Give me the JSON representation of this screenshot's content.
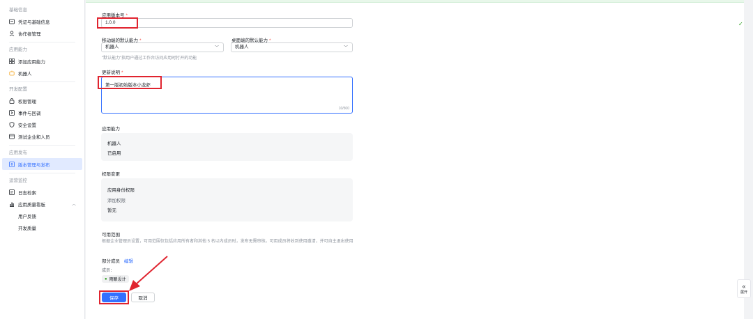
{
  "sidebar": {
    "sections": [
      {
        "title": "基础信息",
        "items": [
          {
            "label": "凭证与基础信息",
            "icon": "id-card-icon"
          },
          {
            "label": "协作者管理",
            "icon": "user-icon"
          }
        ]
      },
      {
        "title": "应用能力",
        "items": [
          {
            "label": "添加应用能力",
            "icon": "grid-icon"
          },
          {
            "label": "机器人",
            "icon": "robot-icon"
          }
        ]
      },
      {
        "title": "开发配置",
        "items": [
          {
            "label": "权限管理",
            "icon": "lock-icon"
          },
          {
            "label": "事件与回调",
            "icon": "event-icon"
          },
          {
            "label": "安全设置",
            "icon": "shield-icon"
          },
          {
            "label": "测试企业和人员",
            "icon": "test-icon"
          }
        ]
      },
      {
        "title": "应用发布",
        "items": [
          {
            "label": "版本管理与发布",
            "icon": "publish-icon"
          }
        ]
      },
      {
        "title": "运营监控",
        "items": [
          {
            "label": "日志检索",
            "icon": "log-icon"
          },
          {
            "label": "应用质量看板",
            "icon": "chart-icon"
          },
          {
            "label": "用户反馈",
            "icon": ""
          },
          {
            "label": "开发质量",
            "icon": ""
          }
        ]
      }
    ]
  },
  "form": {
    "version_label": "应用版本号",
    "version_value": "1.0.0",
    "mobile_default_label": "移动端的默认能力",
    "mobile_default_value": "机器人",
    "desktop_default_label": "桌面端的默认能力",
    "desktop_default_value": "机器人",
    "default_hint": "\"默认能力\"指用户通过工作台访问应用时打开的功能",
    "update_label": "更新说明",
    "update_value": "第一版初始版本小龙虾",
    "update_count": "10/500",
    "capability_title": "应用能力",
    "capability_name": "机器人",
    "capability_status": "已启用",
    "permission_title": "权限变更",
    "permission_line1": "应用身份权限",
    "permission_line2": "添加权限",
    "permission_line3": "暂无",
    "scope_title": "可用范围",
    "scope_desc": "根据企业管理员设置，可用范围仅包括应用所有者和其他 5 名以内成员时，发布无需审核。可用成员将收到使用邀请，并可自主退出使用",
    "scope_partial": "部分成员",
    "scope_edit": "编辑",
    "member_label": "成员：",
    "member_tag": "雨酿设计",
    "save_button": "保存",
    "cancel_button": "取消"
  },
  "right": {
    "expand_label": "展开"
  },
  "colors": {
    "accent": "#3370ff",
    "annotation": "#e0242f",
    "required": "#f54a45"
  }
}
